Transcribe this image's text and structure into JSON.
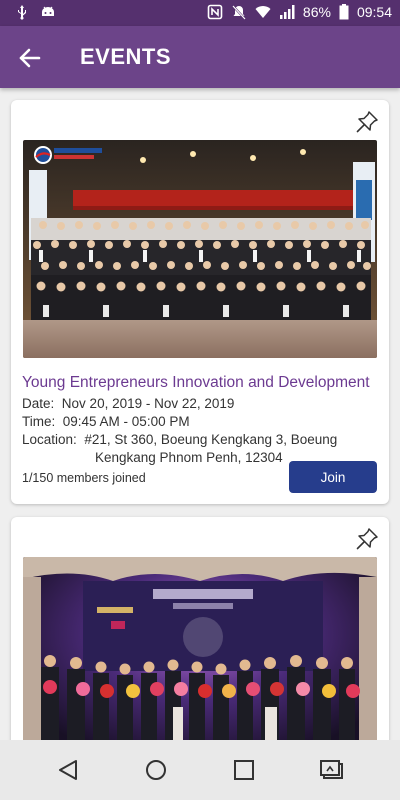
{
  "statusbar": {
    "battery": "86%",
    "time": "09:54",
    "icons": [
      "usb-icon",
      "android-icon",
      "nfc-icon",
      "mute-icon",
      "wifi-icon",
      "signal-icon",
      "battery-icon"
    ]
  },
  "appbar": {
    "title": "EVENTS",
    "back_icon": "arrow-left-icon"
  },
  "events": [
    {
      "title": "Young Entrepreneurs Innovation and Development",
      "date_label": "Date:",
      "date": "Nov 20, 2019 - Nov 22, 2019",
      "time_label": "Time:",
      "time": "09:45 AM - 05:00 PM",
      "location_label": "Location:",
      "location_line1": "#21, St 360, Boeung Kengkang 3, Boeung",
      "location_line2": "Kengkang Phnom Penh, 12304",
      "members": "1/150 members joined",
      "join_label": "Join",
      "photo": {
        "banner_text": "Welcome to attend China-ASEAN Young Entrepreneurs \"One Belt and Road\" (Yunnan) Economic and Trade Activities",
        "logo_text": "សមាគមសហគ្រិនវ័យក្មេងកម្ពុជា"
      }
    },
    {
      "photo": {
        "banner_text": "សន្និសីទសហគ្រិនវ័យក្មេងកម្ពុជា",
        "sponsor_text": "LG"
      }
    }
  ],
  "navbar": {
    "icons": [
      "back-triangle-icon",
      "home-circle-icon",
      "recents-square-icon",
      "cast-screen-icon"
    ]
  },
  "colors": {
    "statusbar": "#55306e",
    "appbar": "#6c4489",
    "title_text": "#6c3a91",
    "join_button": "#263d8c"
  }
}
